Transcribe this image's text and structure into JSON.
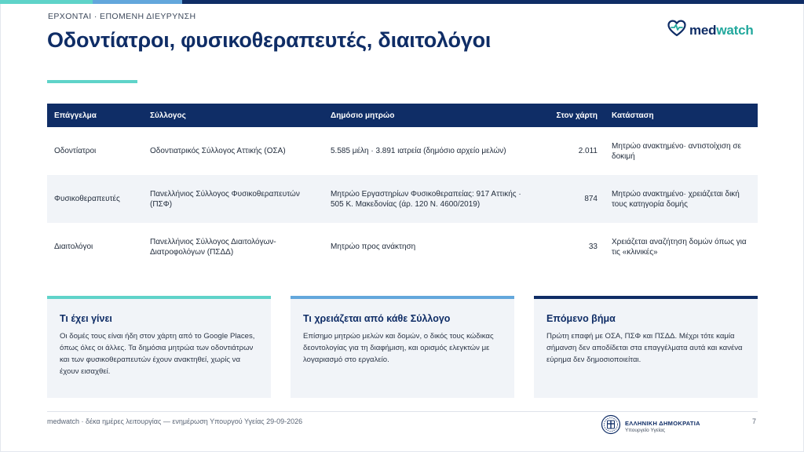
{
  "header": {
    "eyebrow": "ΕΡΧΟΝΤΑΙ · ΕΠΟΜΕΝΗ ΔΙΕΥΡΥΝΣΗ",
    "title": "Οδοντίατροι, φυσικοθεραπευτές, διαιτολόγοι"
  },
  "logo": {
    "part1": "med",
    "part2": "watch",
    "icon": "heart-pulse-icon"
  },
  "table": {
    "headers": [
      "Επάγγελμα",
      "Σύλλογος",
      "Δημόσιο μητρώο",
      "Στον χάρτη",
      "Κατάσταση"
    ],
    "rows": [
      [
        "Οδοντίατροι",
        "Οδοντιατρικός Σύλλογος Αττικής (ΟΣΑ)",
        "5.585 μέλη · 3.891 ιατρεία (δημόσιο αρχείο μελών)",
        "2.011",
        "Μητρώο ανακτημένο· αντιστοίχιση σε δοκιμή"
      ],
      [
        "Φυσικοθεραπευτές",
        "Πανελλήνιος Σύλλογος Φυσικοθεραπευτών (ΠΣΦ)",
        "Μητρώο Εργαστηρίων Φυσικοθεραπείας: 917 Αττικής · 505 Κ. Μακεδονίας (άρ. 120 Ν. 4600/2019)",
        "874",
        "Μητρώο ανακτημένο· χρειάζεται δική τους κατηγορία δομής"
      ],
      [
        "Διαιτολόγοι",
        "Πανελλήνιος Σύλλογος Διαιτολόγων-Διατροφολόγων (ΠΣΔΔ)",
        "Μητρώο προς ανάκτηση",
        "33",
        "Χρειάζεται αναζήτηση δομών όπως για τις «κλινικές»"
      ]
    ]
  },
  "cards": [
    {
      "title": "Τι έχει γίνει",
      "body": "Οι δομές τους είναι ήδη στον χάρτη από το Google Places, όπως όλες οι άλλες. Τα δημόσια μητρώα των οδοντιάτρων και των φυσικοθεραπευτών έχουν ανακτηθεί, χωρίς να έχουν εισαχθεί."
    },
    {
      "title": "Τι χρειάζεται από κάθε Σύλλογο",
      "body": "Επίσημο μητρώο μελών και δομών, ο δικός τους κώδικας δεοντολογίας για τη διαφήμιση, και ορισμός ελεγκτών με λογαριασμό στο εργαλείο."
    },
    {
      "title": "Επόμενο βήμα",
      "body": "Πρώτη επαφή με ΟΣΑ, ΠΣΦ και ΠΣΔΔ. Μέχρι τότε καμία σήμανση δεν αποδίδεται στα επαγγέλματα αυτά και κανένα εύρημα δεν δημοσιοποιείται."
    }
  ],
  "footer": {
    "text": "medwatch · δέκα ημέρες λειτουργίας — ενημέρωση Υπουργού Υγείας 29-09-2026",
    "emblem_line1": "ΕΛΛΗΝΙΚΗ ΔΗΜΟΚΡΑΤΙΑ",
    "emblem_line2": "Υπουργείο Υγείας",
    "page": "7"
  },
  "colors": {
    "navy": "#0f2d66",
    "teal": "#5fd3c9",
    "blue": "#63a7dc",
    "panel": "#f1f4f8"
  }
}
